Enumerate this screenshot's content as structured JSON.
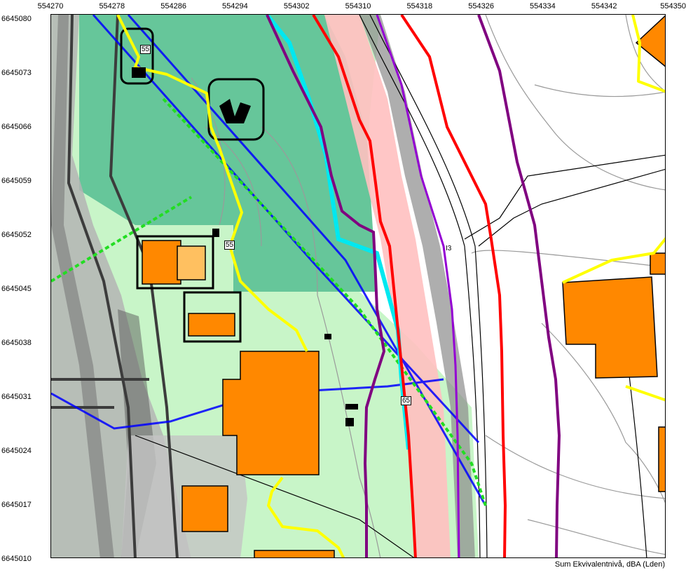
{
  "map": {
    "x_ticks": [
      "554270",
      "554278",
      "554286",
      "554294",
      "554302",
      "554310",
      "554318",
      "554326",
      "554334",
      "554342",
      "554350"
    ],
    "y_ticks": [
      "6645080",
      "6645073",
      "6645066",
      "6645059",
      "6645052",
      "6645045",
      "6645038",
      "6645031",
      "6645024",
      "6645017",
      "6645010"
    ],
    "caption": "Sum Ekvivalentnivå, dBA (Lden)",
    "contour_labels": {
      "label_55_top": "55",
      "label_55_mid": "55",
      "label_65": "65",
      "label_road": "I3"
    },
    "colors": {
      "zone_green_dark": "#66c69a",
      "zone_green_light": "#c8f5c8",
      "building_fill": "#ff8800",
      "contour_55": "#ffff00",
      "contour_60": "#00e8f0",
      "contour_65_red": "#ff0000",
      "contour_70_purple": "#800080",
      "contour_violet": "#9400d3",
      "road_pink": "#ffc0c0",
      "line_blue": "#0000ff",
      "line_green_dashed": "#22dd22"
    }
  }
}
